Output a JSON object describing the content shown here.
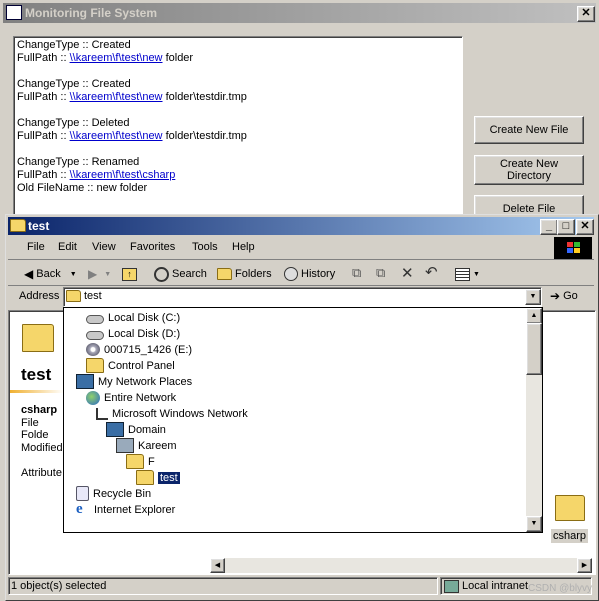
{
  "monitor": {
    "title": "Monitoring File System",
    "close": "✕",
    "log": [
      {
        "label": "ChangeType :: ",
        "value": "Created"
      },
      {
        "label": "FullPath :: ",
        "link": "\\\\kareem\\f\\test\\new",
        "rest": " folder"
      },
      {
        "label": "ChangeType :: ",
        "value": "Created"
      },
      {
        "label": "FullPath :: ",
        "link": "\\\\kareem\\f\\test\\new",
        "rest": " folder\\testdir.tmp"
      },
      {
        "label": "ChangeType :: ",
        "value": "Deleted"
      },
      {
        "label": "FullPath :: ",
        "link": "\\\\kareem\\f\\test\\new",
        "rest": " folder\\testdir.tmp"
      },
      {
        "label": "ChangeType :: ",
        "value": "Renamed"
      },
      {
        "label": "FullPath :: ",
        "link": "\\\\kareem\\f\\test\\csharp",
        "rest": ""
      },
      {
        "label": "Old FileName :: ",
        "value": "new folder"
      }
    ],
    "buttons": {
      "create_file": "Create New File",
      "create_dir_1": "Create New",
      "create_dir_2": "Directory",
      "delete_file": "Delete File"
    }
  },
  "explorer": {
    "title": "test",
    "caption_buttons": {
      "min": "_",
      "max": "□",
      "close": "✕"
    },
    "menu": [
      "File",
      "Edit",
      "View",
      "Favorites",
      "Tools",
      "Help"
    ],
    "toolbar": {
      "back": "Back",
      "search": "Search",
      "folders": "Folders",
      "history": "History"
    },
    "address": {
      "label": "Address",
      "value": "test",
      "go": "Go"
    },
    "left_panel": {
      "folder_title": "test",
      "item_name": "csharp",
      "item_type": "File Folde",
      "modified": "Modified",
      "attributes": "Attribute"
    },
    "dropdown": [
      {
        "label": "Local Disk (C:)",
        "icon": "drive-icon",
        "indent": 0
      },
      {
        "label": "Local Disk (D:)",
        "icon": "drive-icon",
        "indent": 0
      },
      {
        "label": "000715_1426 (E:)",
        "icon": "cd-drive-icon",
        "indent": 0
      },
      {
        "label": "Control Panel",
        "icon": "control-panel-icon",
        "indent": 0
      },
      {
        "label": "My Network Places",
        "icon": "network-places-icon",
        "indent": -1
      },
      {
        "label": "Entire Network",
        "icon": "globe-icon",
        "indent": 0
      },
      {
        "label": "Microsoft Windows Network",
        "icon": "network-icon",
        "indent": 1
      },
      {
        "label": "Domain",
        "icon": "domain-icon",
        "indent": 2
      },
      {
        "label": "Kareem",
        "icon": "computer-icon",
        "indent": 3
      },
      {
        "label": "F",
        "icon": "share-folder-icon",
        "indent": 4
      },
      {
        "label": "test",
        "icon": "folder-icon",
        "indent": 5,
        "selected": true
      },
      {
        "label": "Recycle Bin",
        "icon": "recycle-bin-icon",
        "indent": -1
      },
      {
        "label": "Internet Explorer",
        "icon": "ie-icon",
        "indent": -1
      }
    ],
    "right_item": "csharp",
    "status": {
      "left": "1 object(s) selected",
      "zone": "Local intranet"
    },
    "watermark": "CSDN @blyvy"
  },
  "colors": {
    "titlebar_active": "#0a246a",
    "titlebar_inactive": "#808080",
    "selection": "#0a246a"
  }
}
